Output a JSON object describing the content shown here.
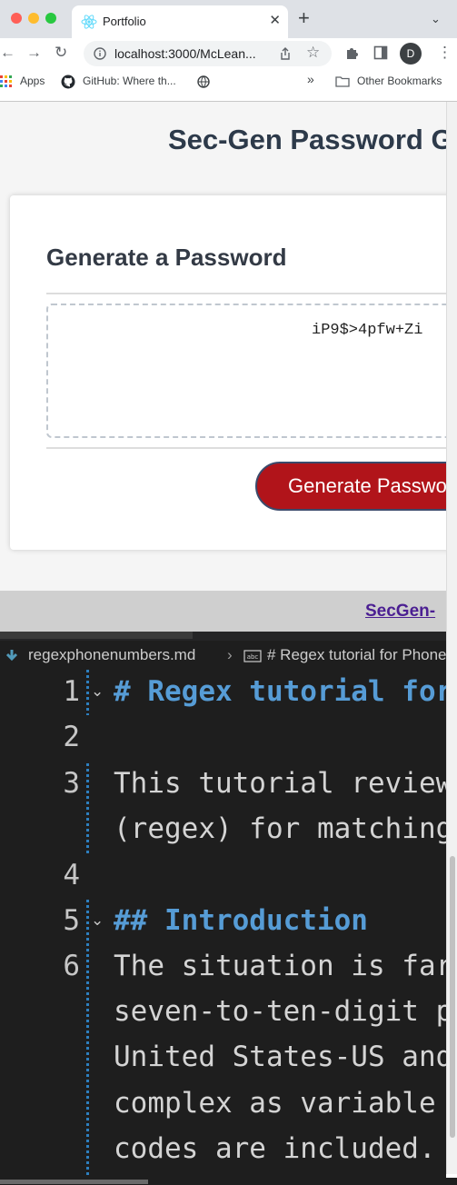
{
  "browser": {
    "tab_title": "Portfolio",
    "tab_close": "✕",
    "new_tab": "+",
    "tab_menu": "⌄",
    "url": "localhost:3000/McLean...",
    "avatar_letter": "D",
    "bookmarks": {
      "apps": "Apps",
      "github": "GitHub: Where th...",
      "more": "»",
      "other": "Other Bookmarks"
    },
    "traffic_lights": [
      "#ff5f57",
      "#febc2e",
      "#28c840"
    ]
  },
  "page": {
    "title": "Sec-Gen Password Generator",
    "card_title": "Generate a Password",
    "password": "iP9$>4pfw+Zi",
    "generate_button": "Generate Password",
    "footer_link": "SecGen-",
    "accent_color": "#b1141a"
  },
  "editor": {
    "breadcrumb_file": "regexphonenumbers.md",
    "breadcrumb_symbol": "# Regex tutorial for Phone Numbers",
    "lines": [
      {
        "num": "1",
        "text": "# Regex tutorial for Phone Numbers"
      },
      {
        "num": "2",
        "text": ""
      },
      {
        "num": "3",
        "text": "This tutorial reviews regular expressions"
      },
      {
        "num": "",
        "text": "(regex) for matching phone numbers"
      },
      {
        "num": "4",
        "text": ""
      },
      {
        "num": "5",
        "text": "## Introduction"
      },
      {
        "num": "6",
        "text": "The situation is far from simple for the"
      },
      {
        "num": "",
        "text": "seven-to-ten-digit phone numbers in the"
      },
      {
        "num": "",
        "text": "United States-US and it becomes more"
      },
      {
        "num": "",
        "text": "complex as variable length country"
      },
      {
        "num": "",
        "text": "codes are included."
      }
    ]
  }
}
